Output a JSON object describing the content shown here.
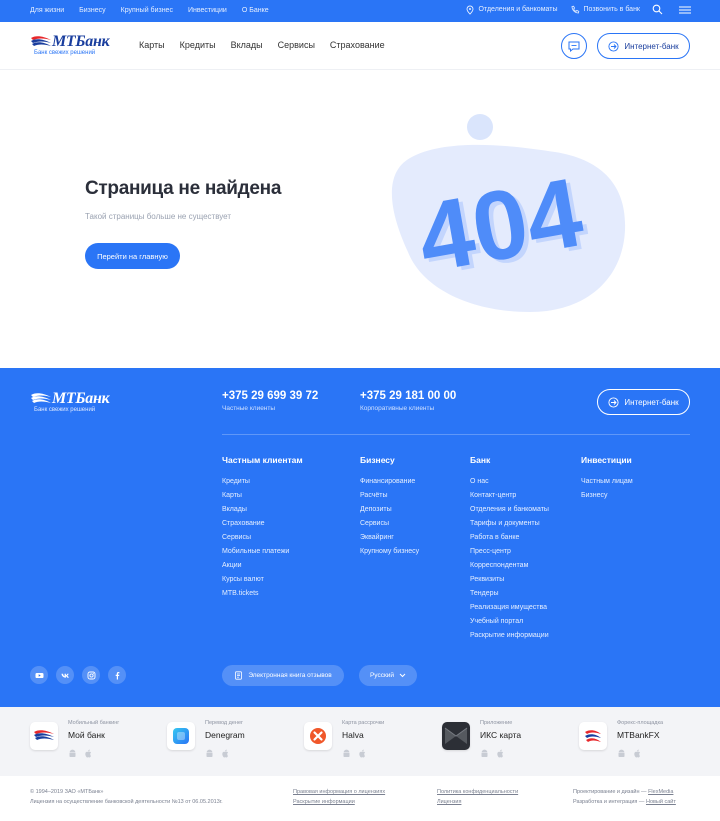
{
  "topbar": {
    "links": [
      "Для жизни",
      "Бизнесу",
      "Крупный бизнес",
      "Инвестиции",
      "О Банке"
    ],
    "branches": "Отделения и банкоматы",
    "call": "Позвонить в банк"
  },
  "header": {
    "logo_name": "МТБанк",
    "logo_slogan": "Банк свежих решений",
    "nav": [
      "Карты",
      "Кредиты",
      "Вклады",
      "Сервисы",
      "Страхование"
    ],
    "internet_bank": "Интернет-банк"
  },
  "hero": {
    "title": "Страница не найдена",
    "subtitle": "Такой страницы больше не существует",
    "button": "Перейти на главную",
    "illustration_text": "404"
  },
  "footer": {
    "logo_name": "МТБанк",
    "logo_slogan": "Банк свежих решений",
    "phones": [
      {
        "number": "+375 29 699 39 72",
        "label": "Частные клиенты"
      },
      {
        "number": "+375 29 181 00 00",
        "label": "Корпоративные клиенты"
      }
    ],
    "internet_bank": "Интернет-банк",
    "columns": [
      {
        "title": "Частным клиентам",
        "links": [
          "Кредиты",
          "Карты",
          "Вклады",
          "Страхование",
          "Сервисы",
          "Мобильные платежи",
          "Акции",
          "Курсы валют",
          "MTB.tickets"
        ]
      },
      {
        "title": "Бизнесу",
        "links": [
          "Финансирование",
          "Расчёты",
          "Депозиты",
          "Сервисы",
          "Эквайринг",
          "Крупному бизнесу"
        ]
      },
      {
        "title": "Банк",
        "links": [
          "О нас",
          "Контакт-центр",
          "Отделения и банкоматы",
          "Тарифы и документы",
          "Работа в банке",
          "Пресс-центр",
          "Корреспондентам",
          "Реквизиты",
          "Тендеры",
          "Реализация имущества",
          "Учебный портал",
          "Раскрытие информации"
        ]
      },
      {
        "title": "Инвестиции",
        "links": [
          "Частным лицам",
          "Бизнесу"
        ]
      }
    ],
    "reviews": "Электронная книга отзывов",
    "language": "Русский"
  },
  "apps": [
    {
      "caption": "Мобильный банкинг",
      "title": "Мой банк",
      "icon": "mtbank-logo-icon"
    },
    {
      "caption": "Перевод денег",
      "title": "Denegram",
      "icon": "denegram-icon"
    },
    {
      "caption": "Карта рассрочки",
      "title": "Halva",
      "icon": "halva-icon"
    },
    {
      "caption": "Приложение",
      "title": "ИКС карта",
      "icon": "iks-card-icon"
    },
    {
      "caption": "Форекс-площадка",
      "title": "MTBankFX",
      "icon": "mtbankfx-icon"
    }
  ],
  "bottom": {
    "copyright": "© 1994–2019 ЗАО «МТБанк»",
    "license": "Лицензия на осуществление банковской деятельности №13 от 06.05.2013г.",
    "legal_links": [
      "Правовая информация о лицензиях",
      "Раскрытие информации"
    ],
    "privacy_links": [
      "Политика конфиденциальности",
      "Лицензия"
    ],
    "design_prefix": "Проектирование и дизайн —",
    "design_link": "FlexMedia",
    "dev_prefix": "Разработка и интеграция —",
    "dev_link": "Новый сайт"
  },
  "colors": {
    "primary": "#2a75f6",
    "logo_navy": "#1a3e9e",
    "app_strip": "#f3f4f7"
  }
}
